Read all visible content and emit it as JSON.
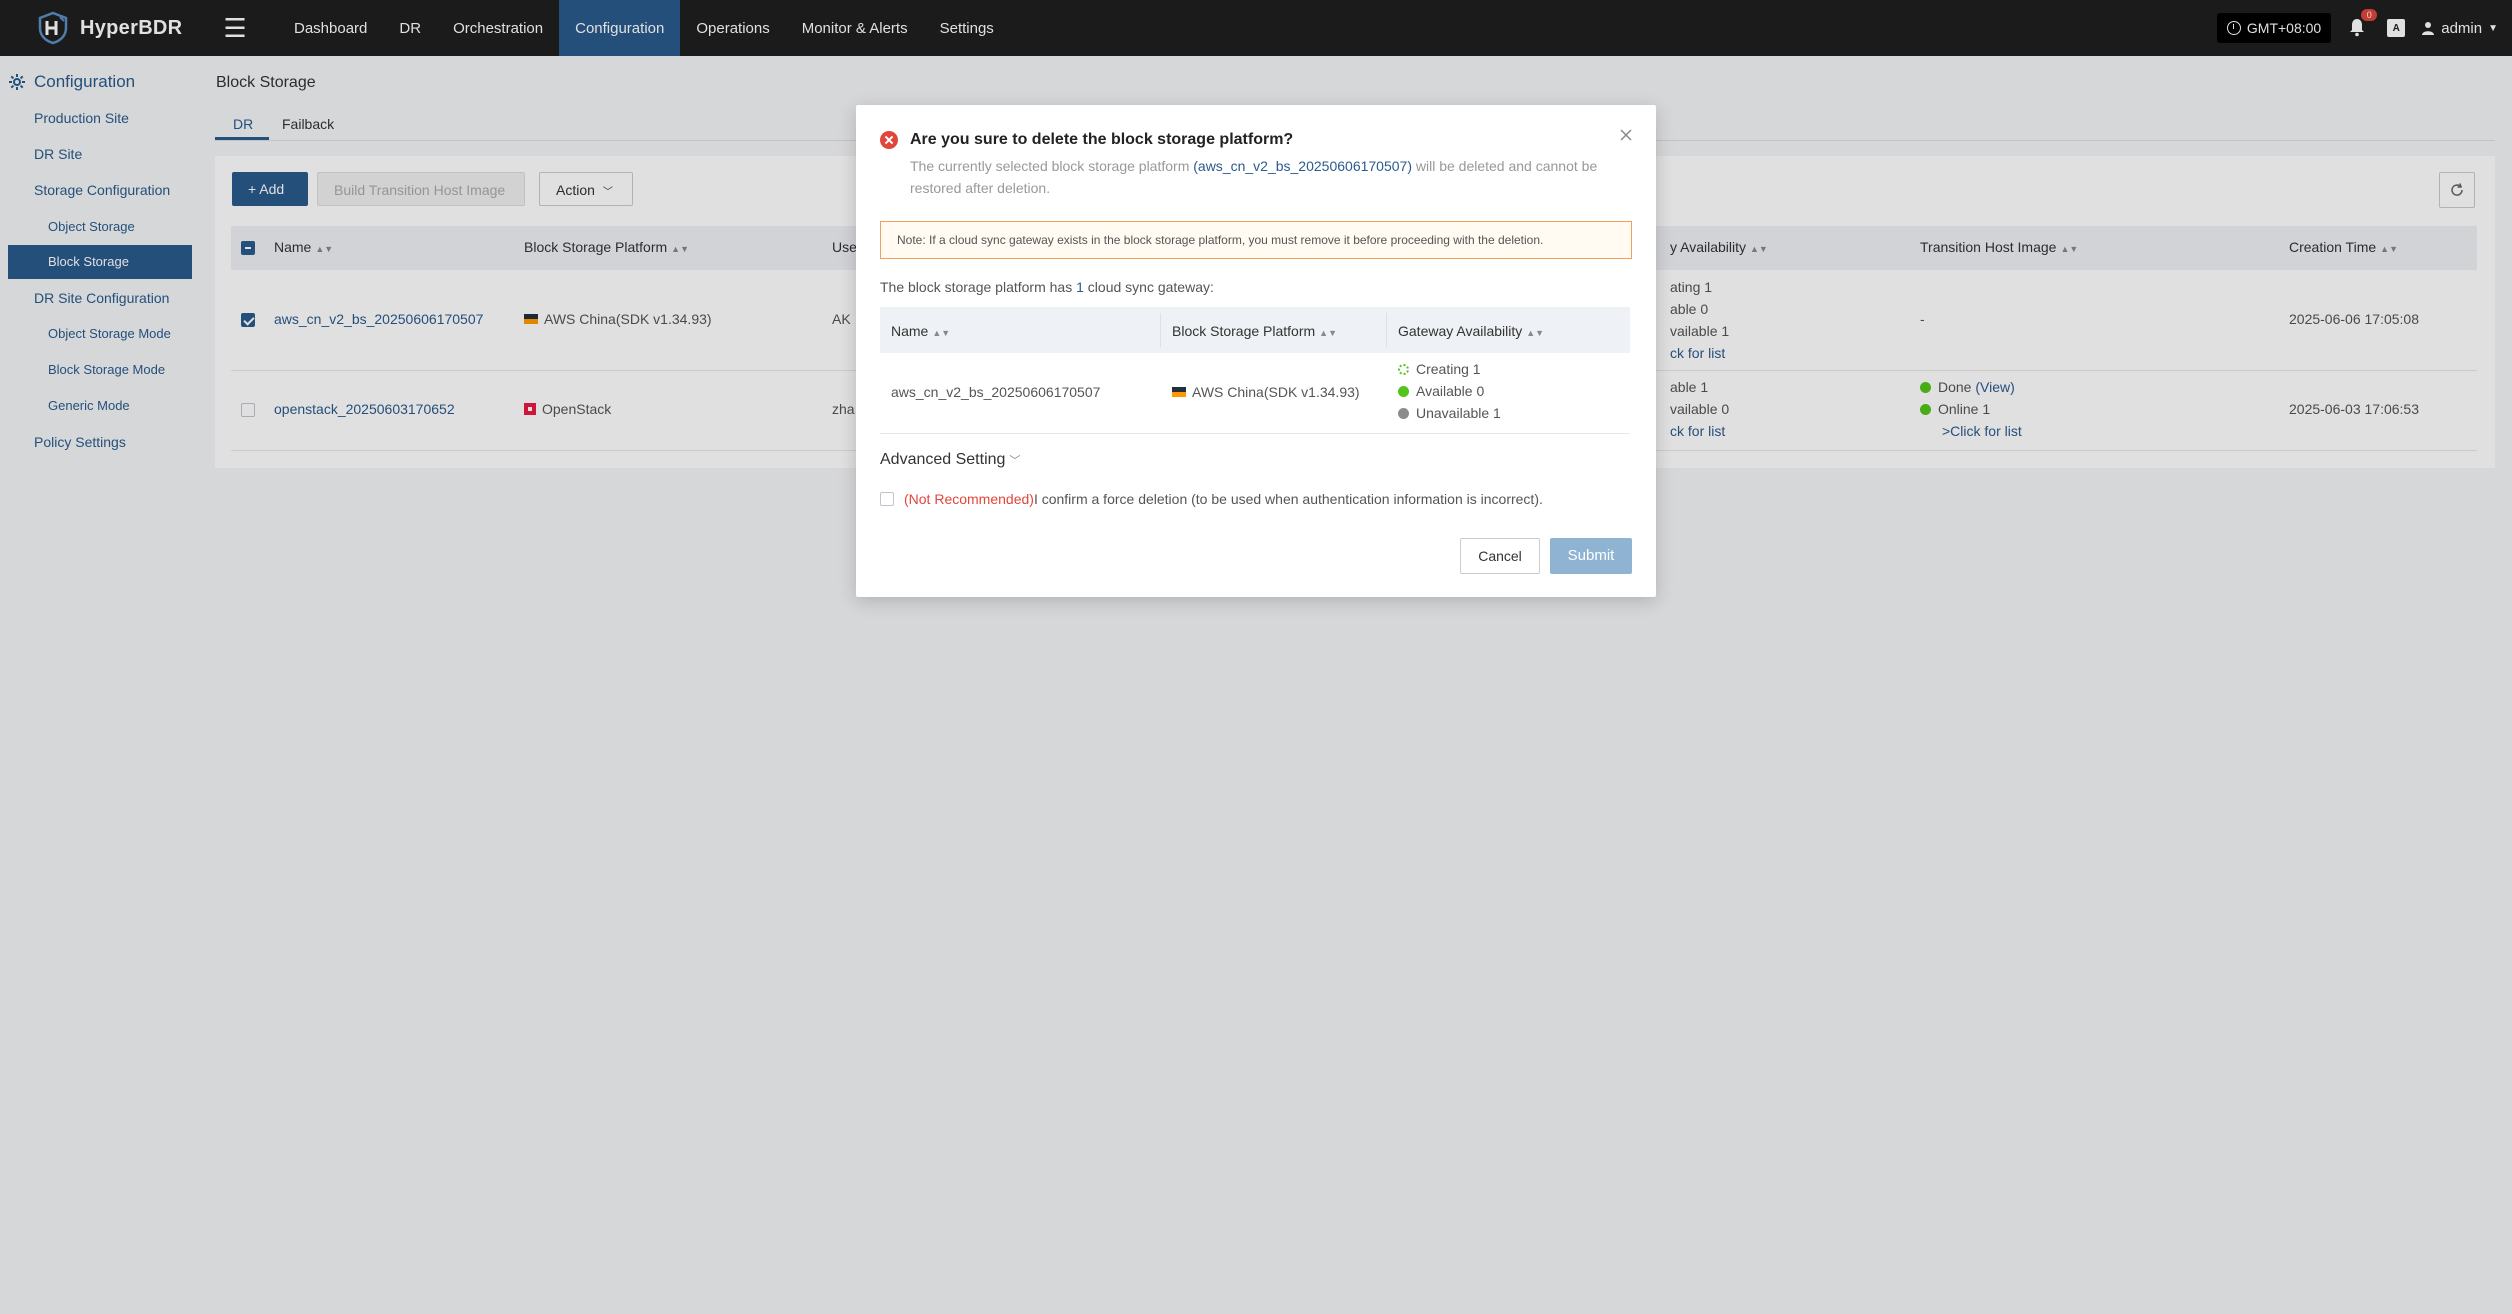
{
  "brand": {
    "name": "HyperBDR"
  },
  "nav": {
    "items": [
      "Dashboard",
      "DR",
      "Orchestration",
      "Configuration",
      "Operations",
      "Monitor & Alerts",
      "Settings"
    ],
    "active": "Configuration"
  },
  "topright": {
    "timezone": "GMT+08:00",
    "notifications": "0",
    "lang_glyph": "A",
    "user": "admin"
  },
  "sidebar": {
    "title": "Configuration",
    "items": [
      {
        "label": "Production Site"
      },
      {
        "label": "DR Site"
      },
      {
        "label": "Storage Configuration"
      },
      {
        "label": "Object Storage"
      },
      {
        "label": "Block Storage"
      },
      {
        "label": "DR Site Configuration"
      },
      {
        "label": "Object Storage Mode"
      },
      {
        "label": "Block Storage Mode"
      },
      {
        "label": "Generic Mode"
      },
      {
        "label": "Policy Settings"
      }
    ],
    "active": "Block Storage"
  },
  "page": {
    "title": "Block Storage",
    "tabs": [
      "DR",
      "Failback"
    ],
    "active_tab": "DR",
    "toolbar": {
      "add": "+ Add",
      "build": "Build Transition Host Image",
      "action": "Action"
    }
  },
  "table": {
    "columns": [
      "Name",
      "Block Storage Platform",
      "Use",
      "y Availability",
      "Transition Host Image",
      "Creation Time"
    ],
    "rows": [
      {
        "checked": true,
        "name": "aws_cn_v2_bs_20250606170507",
        "platform": "AWS China(SDK v1.34.93)",
        "user": "AK",
        "availability": [
          "ating 1",
          "able 0",
          "vailable 1",
          "ck for list"
        ],
        "image": "-",
        "created": "2025-06-06 17:05:08"
      },
      {
        "checked": false,
        "name": "openstack_20250603170652",
        "platform": "OpenStack",
        "user": "zha",
        "availability": [
          "able 1",
          "vailable 0",
          "ck for list"
        ],
        "image_status": "Done",
        "image_view": "(View)",
        "image_online": "Online 1",
        "image_list": ">Click for list",
        "created": "2025-06-03 17:06:53"
      }
    ]
  },
  "modal": {
    "title": "Are you sure to delete the block storage platform?",
    "desc_before": "The currently selected block storage platform ",
    "desc_name": "(aws_cn_v2_bs_20250606170507)",
    "desc_after": " will be deleted and cannot be restored after deletion.",
    "note": "Note: If a cloud sync gateway exists in the block storage platform, you must remove it before proceeding with the deletion.",
    "count_before": "The block storage platform has ",
    "count": "1",
    "count_after": " cloud sync gateway:",
    "columns": [
      "Name",
      "Block Storage Platform",
      "Gateway Availability"
    ],
    "gateway": {
      "name": "aws_cn_v2_bs_20250606170507",
      "platform": "AWS China(SDK v1.34.93)",
      "creating": "Creating 1",
      "available": "Available 0",
      "unavailable": "Unavailable 1"
    },
    "advanced": "Advanced Setting",
    "force_warn": "(Not Recommended)",
    "force_text": " I confirm a force deletion (to be used when authentication information is incorrect).",
    "cancel": "Cancel",
    "submit": "Submit"
  }
}
